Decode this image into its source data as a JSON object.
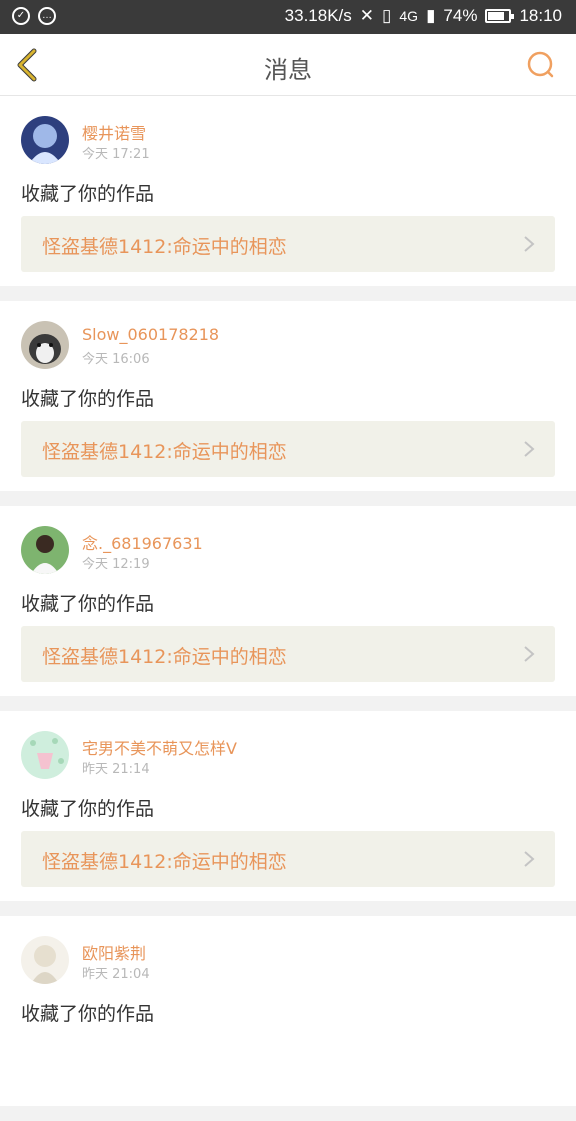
{
  "status_bar": {
    "speed": "33.18K/s",
    "network": "4G",
    "battery": "74%",
    "time": "18:10"
  },
  "header": {
    "title": "消息"
  },
  "messages": [
    {
      "name": "樱井诺雪",
      "time": "今天 17:21",
      "action": "收藏了你的作品",
      "work": "怪盗基德1412:命运中的相恋",
      "avatar_color": "#6f7fc0"
    },
    {
      "name": "Slow_060178218",
      "time": "今天 16:06",
      "action": "收藏了你的作品",
      "work": "怪盗基德1412:命运中的相恋",
      "avatar_color": "#4b4b4b"
    },
    {
      "name": "念._681967631",
      "time": "今天 12:19",
      "action": "收藏了你的作品",
      "work": "怪盗基德1412:命运中的相恋",
      "avatar_color": "#8fc08a"
    },
    {
      "name": "宅男不美不萌又怎样V",
      "time": "昨天 21:14",
      "action": "收藏了你的作品",
      "work": "怪盗基德1412:命运中的相恋",
      "avatar_color": "#b8e2c4"
    },
    {
      "name": "欧阳紫荆",
      "time": "昨天 21:04",
      "action": "收藏了你的作品",
      "work": "",
      "avatar_color": "#e9e6dc"
    }
  ],
  "colors": {
    "accent": "#e8955a",
    "back_arrow": "#d8b430",
    "card_tint": "#f1f1e9"
  }
}
